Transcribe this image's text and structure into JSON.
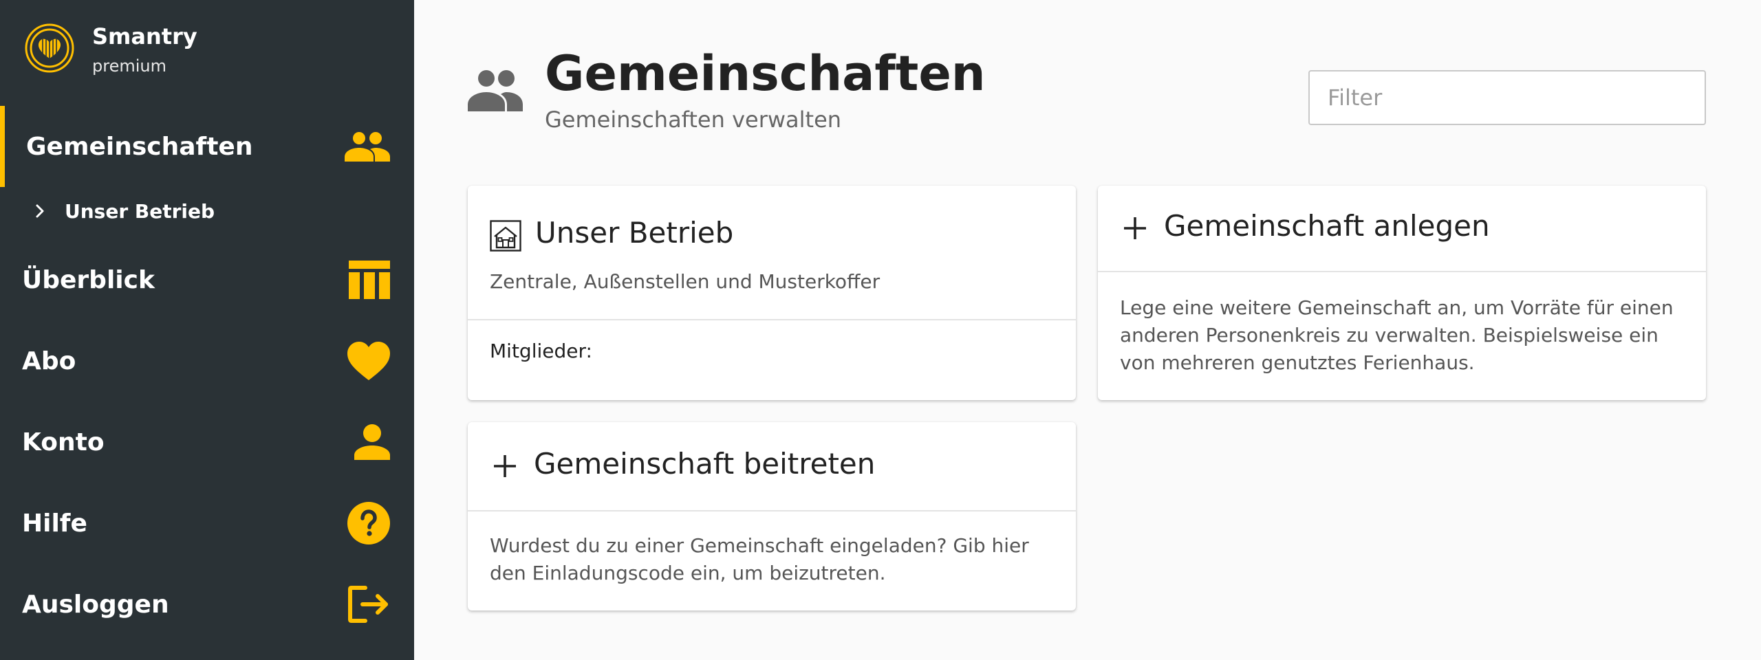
{
  "brand": {
    "name": "Smantry",
    "tier": "premium"
  },
  "sidebar": {
    "items": [
      {
        "label": "Gemeinschaften",
        "icon": "people-icon",
        "active": true
      },
      {
        "label": "Unser Betrieb",
        "icon": "chevron-right-icon",
        "sub": true
      },
      {
        "label": "Überblick",
        "icon": "table-icon"
      },
      {
        "label": "Abo",
        "icon": "heart-icon"
      },
      {
        "label": "Konto",
        "icon": "person-icon"
      },
      {
        "label": "Hilfe",
        "icon": "help-circle-icon"
      },
      {
        "label": "Ausloggen",
        "icon": "logout-icon"
      }
    ],
    "accent": "#ffbf00",
    "background": "#2a3236"
  },
  "header": {
    "title": "Gemeinschaften",
    "subtitle": "Gemeinschaften verwalten",
    "filter_placeholder": "Filter"
  },
  "cards": {
    "community": {
      "title": "Unser Betrieb",
      "description": "Zentrale, Außenstellen und Musterkoffer",
      "members_label": "Mitglieder:"
    },
    "create": {
      "title": "Gemeinschaft anlegen",
      "text": "Lege eine weitere Gemeinschaft an, um Vorräte für einen anderen Personenkreis zu verwalten. Beispielsweise ein von mehreren genutztes Ferienhaus."
    },
    "join": {
      "title": "Gemeinschaft beitreten",
      "text": "Wurdest du zu einer Gemeinschaft eingeladen? Gib hier den Einladungscode ein, um beizutreten."
    }
  }
}
